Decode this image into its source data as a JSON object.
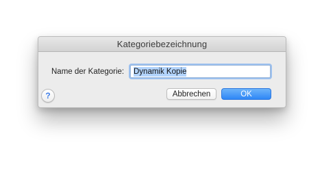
{
  "dialog": {
    "title": "Kategoriebezeichnung",
    "field_label": "Name der Kategorie:",
    "field_value": "Dynamik Kopie",
    "help_symbol": "?",
    "cancel_label": "Abbrechen",
    "ok_label": "OK"
  },
  "colors": {
    "accent": "#2f86f6",
    "selection": "#b3d4fc",
    "dialog_bg": "#ececec"
  },
  "icons": {
    "help": "help-icon"
  }
}
